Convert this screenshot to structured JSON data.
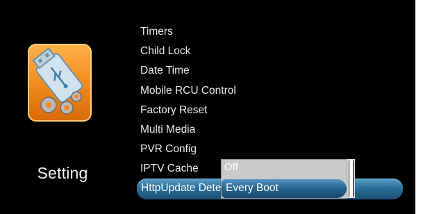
{
  "screen": {
    "title": "Setting"
  },
  "menu": {
    "items": [
      {
        "label": "Timers"
      },
      {
        "label": "Child Lock"
      },
      {
        "label": "Date Time"
      },
      {
        "label": "Mobile RCU Control"
      },
      {
        "label": "Factory Reset"
      },
      {
        "label": "Multi Media"
      },
      {
        "label": "PVR Config"
      },
      {
        "label": "IPTV Cache"
      }
    ],
    "selected_label": "HttpUpdate Detec"
  },
  "dropdown": {
    "options": [
      {
        "label": "Off"
      },
      {
        "label": "Every Boot"
      }
    ],
    "selected": "Every Boot"
  },
  "icons": {
    "setting_icon": "usb-gears-icon"
  },
  "colors": {
    "background": "#000000",
    "highlight": "#2a6f98",
    "icon_orange": "#f08a1c",
    "dropdown_bg": "#c9c9c9"
  }
}
